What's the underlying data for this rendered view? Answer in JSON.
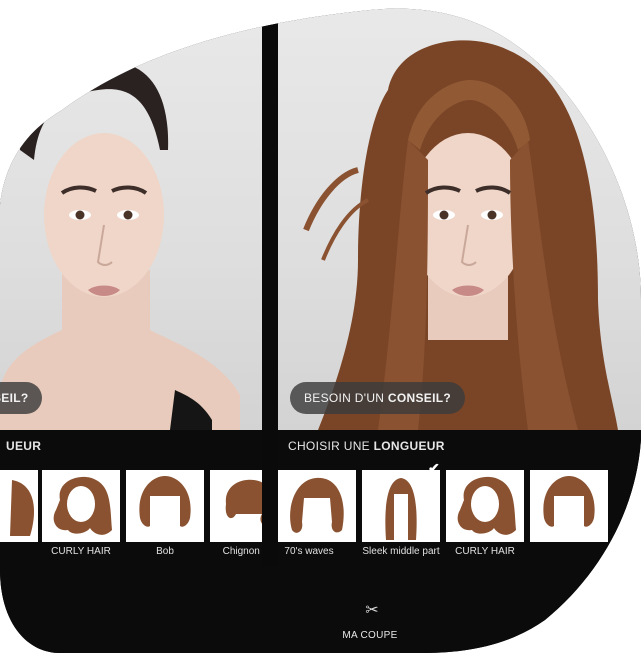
{
  "colors": {
    "background": "#0b0b0b",
    "photo_bg": "#e0e0e0",
    "hair": "#7a4a2a",
    "button_bg": "#3c3c3c",
    "text": "#e6e6e6"
  },
  "left_panel": {
    "advice_button": {
      "normal": "",
      "bold": "NSEIL?"
    },
    "length_bar": {
      "prefix": "",
      "bold": "UEUR"
    },
    "hairstyles": [
      {
        "label": "CURLY HAIR",
        "icon": "curly-hair-icon"
      },
      {
        "label": "Bob",
        "icon": "bob-hair-icon"
      },
      {
        "label": "Chignon Dé",
        "icon": "chignon-hair-icon"
      }
    ]
  },
  "right_panel": {
    "advice_button": {
      "normal": "BESOIN D'UN ",
      "bold": "CONSEIL?"
    },
    "length_bar": {
      "prefix": "CHOISIR UNE ",
      "bold": "LONGUEUR"
    },
    "hairstyles": [
      {
        "label": "70's waves",
        "icon": "waves-hair-icon",
        "selected": false
      },
      {
        "label": "Sleek middle part",
        "icon": "sleek-hair-icon",
        "selected": true
      },
      {
        "label": "CURLY HAIR",
        "icon": "curly-hair-icon",
        "selected": false
      },
      {
        "label": "",
        "icon": "bob-hair-icon",
        "selected": false
      }
    ]
  },
  "bottom_bar": {
    "scissors_icon": "scissors-icon",
    "label": "MA COUPE",
    "scissors_glyph": "✂"
  }
}
